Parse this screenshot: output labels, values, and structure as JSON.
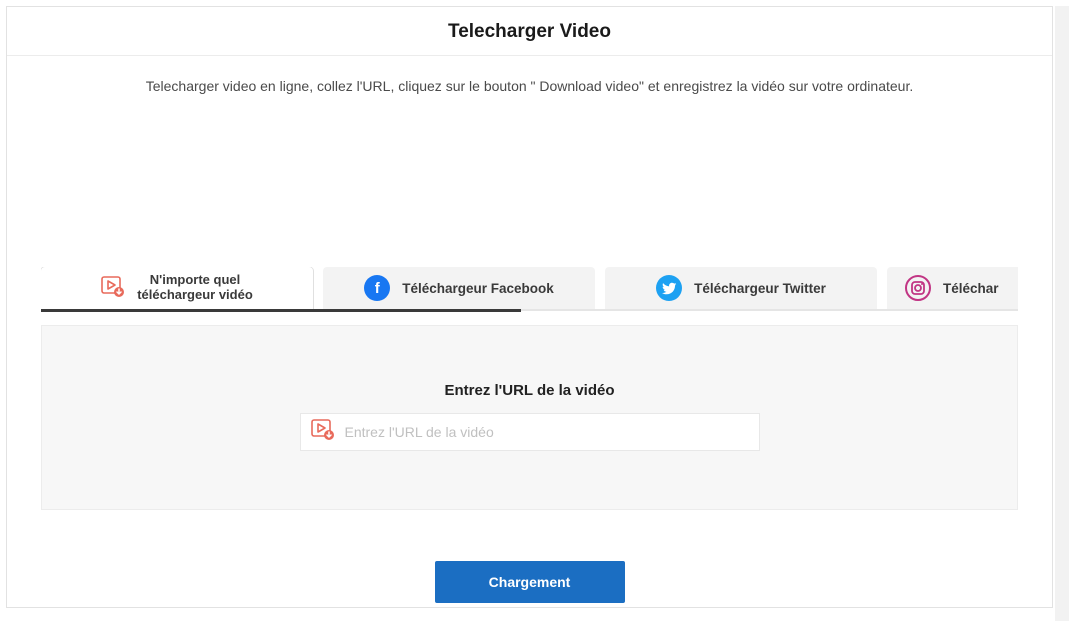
{
  "header": {
    "title": "Telecharger Video",
    "subtitle": "Telecharger video en ligne, collez l'URL, cliquez sur le bouton \" Download video\" et enregistrez la vidéo sur votre ordinateur."
  },
  "tabs": [
    {
      "label": "N'importe quel\ntéléchargeur vidéo",
      "icon": "video-download-icon"
    },
    {
      "label": "Téléchargeur Facebook",
      "icon": "facebook-icon"
    },
    {
      "label": "Téléchargeur Twitter",
      "icon": "twitter-icon"
    },
    {
      "label": "Téléchar",
      "icon": "instagram-icon"
    }
  ],
  "panel": {
    "title": "Entrez l'URL de la vidéo",
    "placeholder": "Entrez l'URL de la vidéo"
  },
  "actions": {
    "load_label": "Chargement"
  },
  "colors": {
    "primary_button": "#1b6ec2",
    "facebook": "#1877f2",
    "twitter": "#1da1f2",
    "instagram": "#c13584",
    "video_icon": "#e86a5b"
  }
}
